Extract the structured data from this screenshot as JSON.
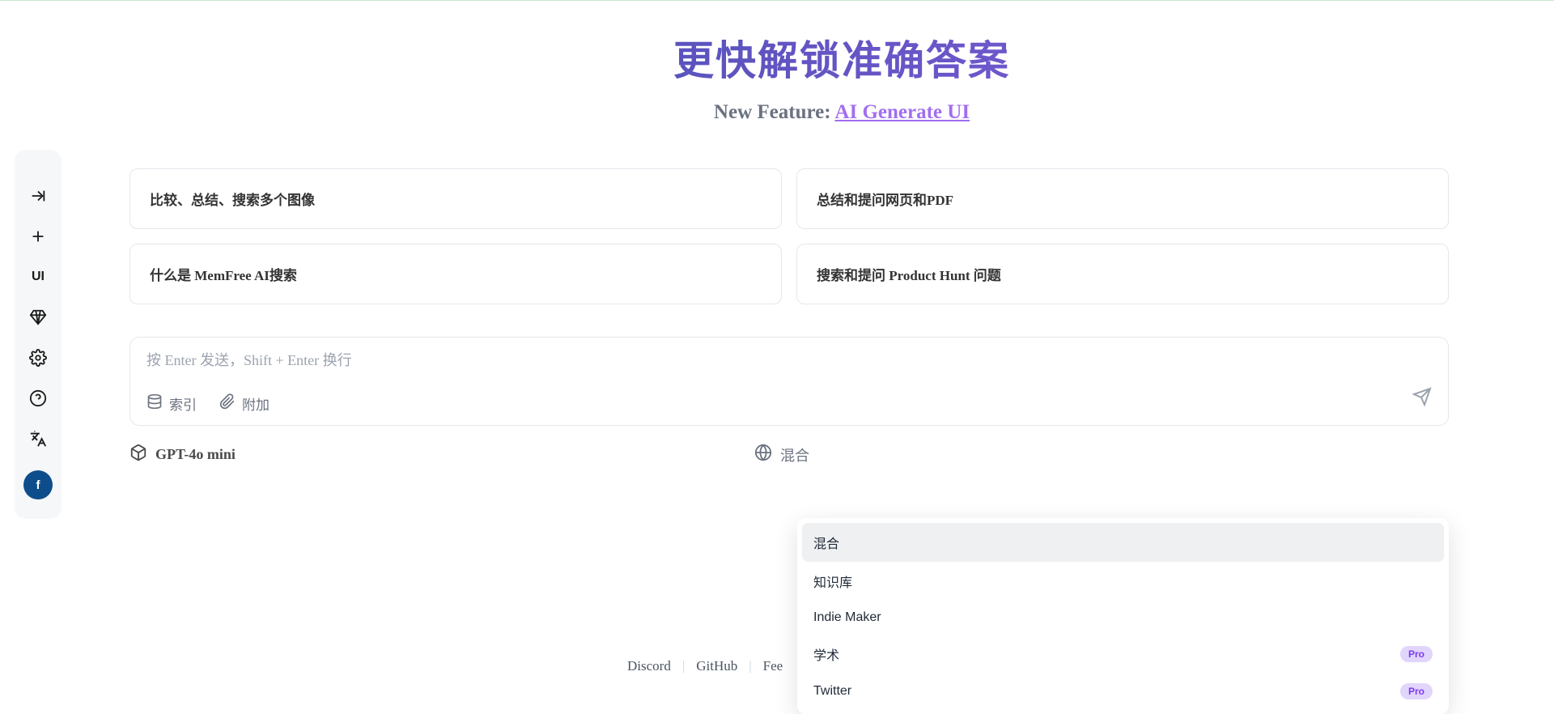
{
  "hero": {
    "title": "更快解锁准确答案",
    "subtitle_prefix": "New Feature: ",
    "subtitle_link": "AI Generate UI"
  },
  "sidebar": {
    "ui_label": "UI",
    "avatar_initial": "f"
  },
  "suggestions": [
    "比较、总结、搜索多个图像",
    "总结和提问网页和PDF",
    "什么是 MemFree AI搜索",
    "搜索和提问 Product Hunt 问题"
  ],
  "input": {
    "placeholder": "按 Enter 发送，Shift + Enter 换行",
    "index_label": "索引",
    "attach_label": "附加"
  },
  "selectors": {
    "model": "GPT-4o mini",
    "source": "混合"
  },
  "dropdown": {
    "items": [
      {
        "label": "混合",
        "selected": true,
        "pro": false
      },
      {
        "label": "知识库",
        "selected": false,
        "pro": false
      },
      {
        "label": "Indie Maker",
        "selected": false,
        "pro": false
      },
      {
        "label": "学术",
        "selected": false,
        "pro": true
      },
      {
        "label": "Twitter",
        "selected": false,
        "pro": true
      }
    ],
    "pro_text": "Pro"
  },
  "footer": {
    "discord": "Discord",
    "github": "GitHub",
    "feedback": "Fee"
  }
}
